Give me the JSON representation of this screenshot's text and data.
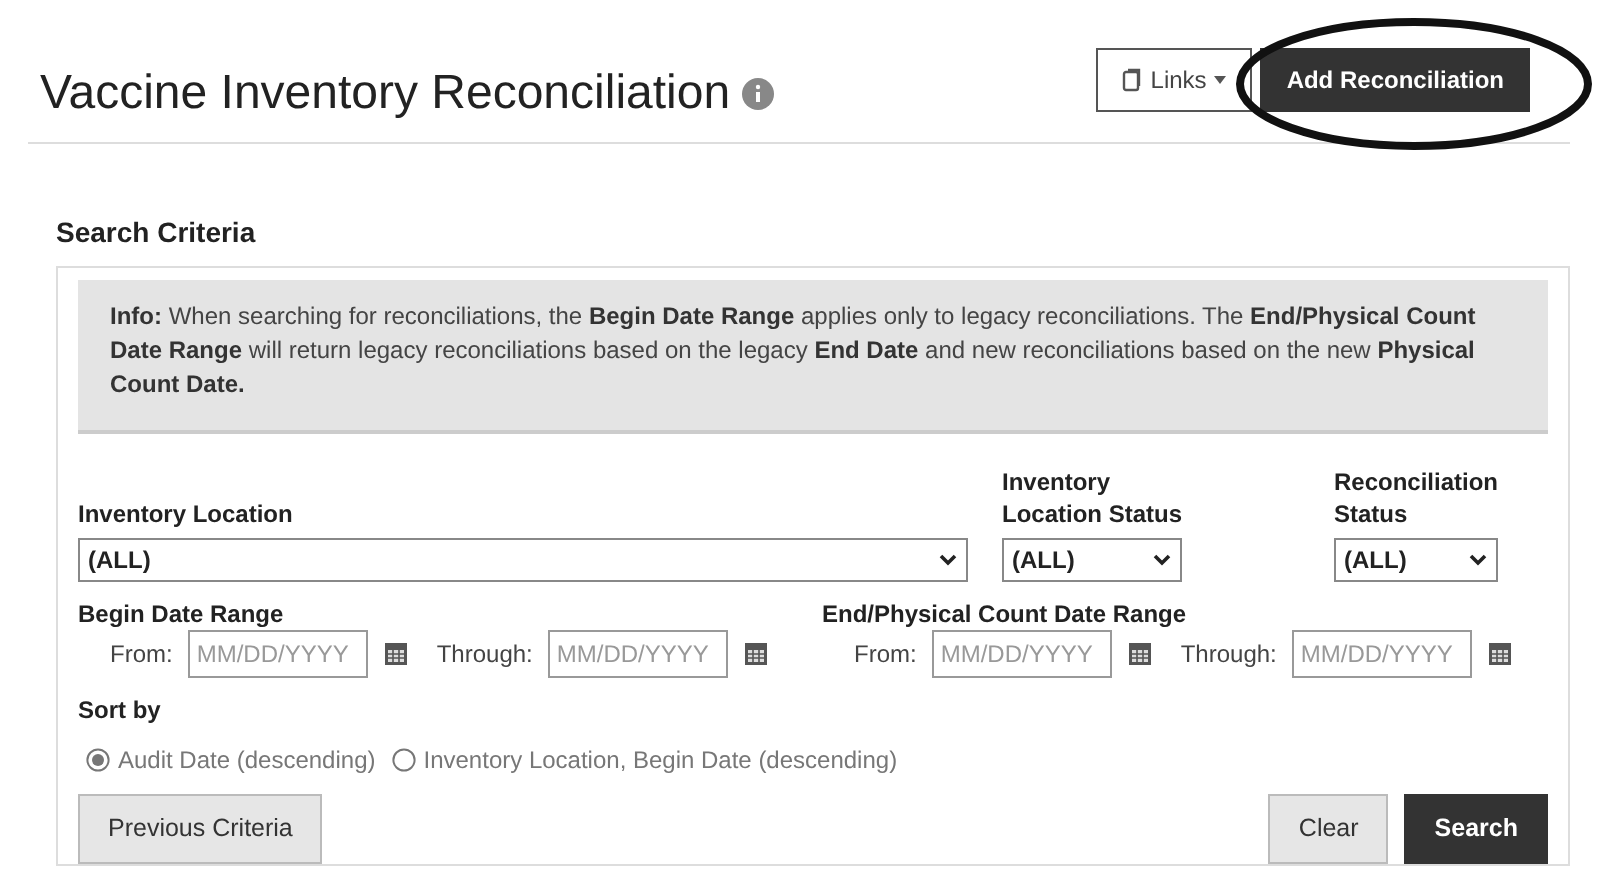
{
  "page": {
    "title": "Vaccine Inventory Reconciliation"
  },
  "header_buttons": [
    {
      "label": "Links",
      "kind": "dropdown"
    },
    {
      "label": "Add Reconciliation",
      "kind": "primary"
    }
  ],
  "section_title": "Search Criteria",
  "info": "**Info:** When searching for reconciliations, the **Begin Date Range** applies only to legacy reconciliations. The **End/Physical Count Date Range** will return legacy reconciliations based on the legacy **End Date** and new reconciliations based on the new **Physical Count Date.**",
  "filters": [
    {
      "label": "Inventory Location",
      "value": "(ALL)"
    },
    {
      "label": "Inventory Location Status",
      "value": "(ALL)"
    },
    {
      "label": "Reconciliation Status",
      "value": "(ALL)"
    }
  ],
  "date_ranges": [
    {
      "label": "Begin Date Range",
      "fields": [
        {
          "label": "From:",
          "placeholder": "MM/DD/YYYY"
        },
        {
          "label": "Through:",
          "placeholder": "MM/DD/YYYY"
        }
      ]
    },
    {
      "label": "End/Physical Count Date Range",
      "fields": [
        {
          "label": "From:",
          "placeholder": "MM/DD/YYYY"
        },
        {
          "label": "Through:",
          "placeholder": "MM/DD/YYYY"
        }
      ]
    }
  ],
  "sort": {
    "label": "Sort by",
    "options": [
      {
        "label": "Audit Date (descending)",
        "selected": true
      },
      {
        "label": "Inventory Location, Begin Date (descending)",
        "selected": false
      }
    ]
  },
  "actions": [
    {
      "label": "Previous Criteria",
      "kind": "secondary"
    },
    {
      "label": "Clear",
      "kind": "secondary"
    },
    {
      "label": "Search",
      "kind": "primary"
    }
  ]
}
